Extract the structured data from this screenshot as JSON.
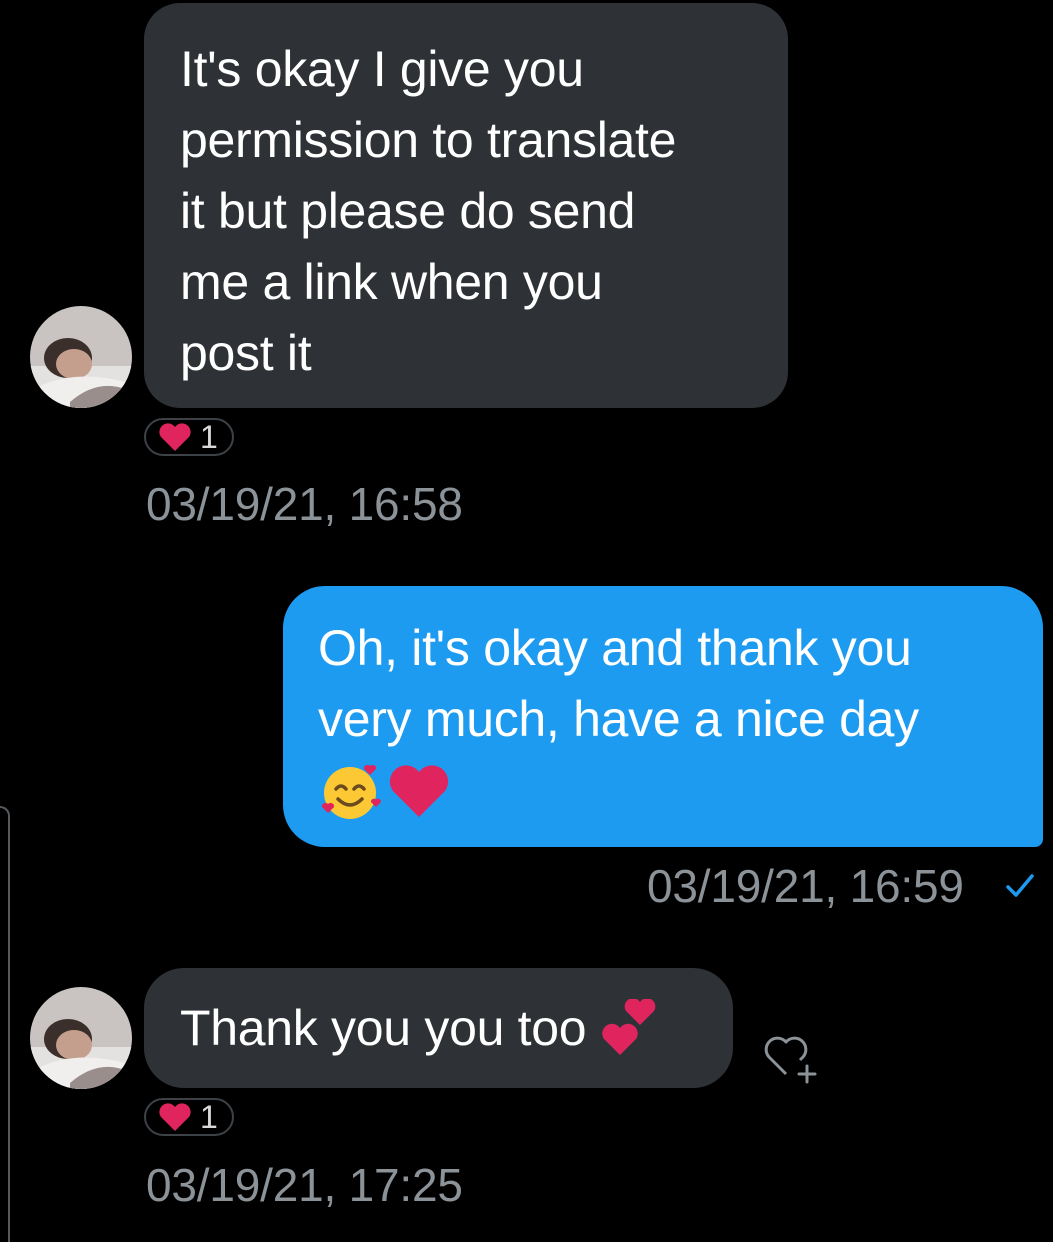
{
  "conversation": {
    "messages": [
      {
        "direction": "incoming",
        "text": "It's okay I give you\npermission to translate\nit but please do send\nme a link when you\npost it",
        "reaction": {
          "icon": "heart-icon",
          "count": "1"
        },
        "timestamp": "03/19/21, 16:58"
      },
      {
        "direction": "outgoing",
        "text": "Oh, it's okay and thank you\nvery much, have a nice day",
        "emojis": [
          "smiling-face-with-hearts-emoji",
          "red-heart-emoji"
        ],
        "timestamp": "03/19/21, 16:59",
        "status_icon": "read-check-icon"
      },
      {
        "direction": "incoming",
        "text": "Thank you you too",
        "emojis": [
          "two-hearts-emoji"
        ],
        "reaction": {
          "icon": "heart-icon",
          "count": "1"
        },
        "timestamp": "03/19/21, 17:25"
      }
    ]
  },
  "colors": {
    "background": "#000000",
    "incoming_bubble": "#2e3236",
    "outgoing_bubble": "#1d9bf0",
    "timestamp": "#8b9298",
    "heart": "#e0245e",
    "check": "#1d9bf0"
  }
}
